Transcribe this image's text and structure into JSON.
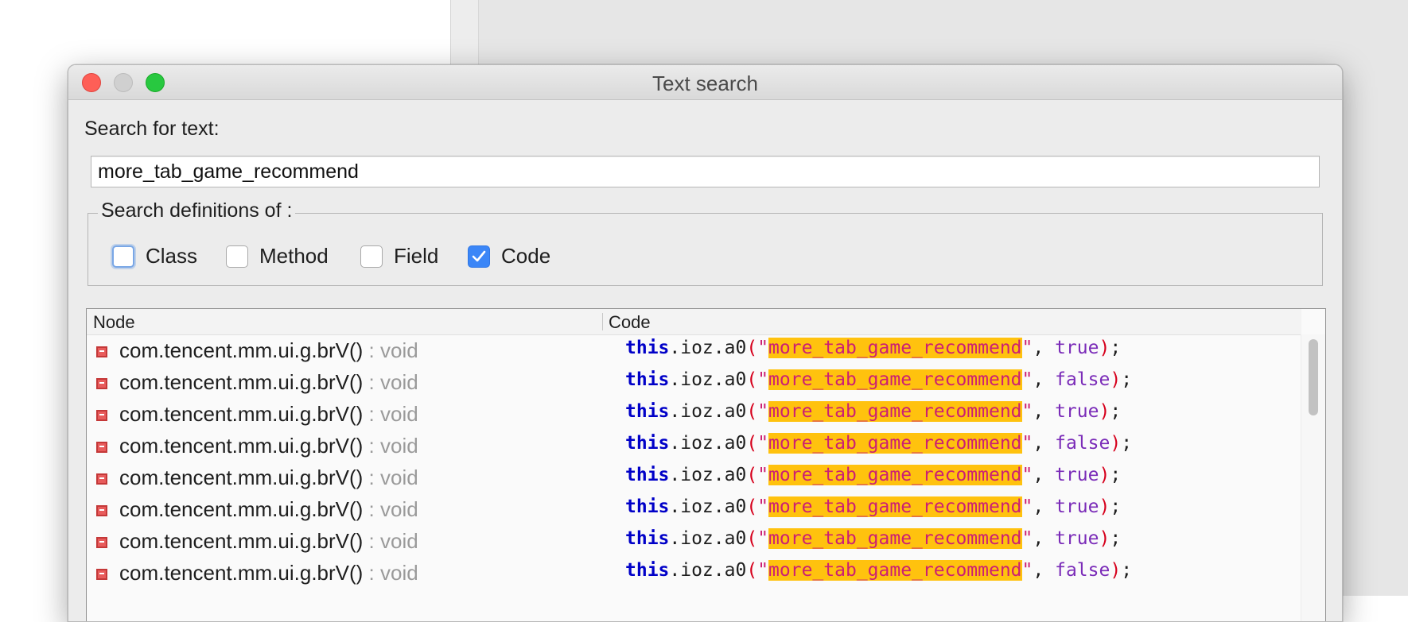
{
  "dialog": {
    "title": "Text search",
    "search_label": "Search for text:",
    "search_value": "more_tab_game_recommend",
    "definitions_legend": "Search definitions of :",
    "checkboxes": [
      {
        "label": "Class",
        "checked": false,
        "focused": true
      },
      {
        "label": "Method",
        "checked": false,
        "focused": false
      },
      {
        "label": "Field",
        "checked": false,
        "focused": false
      },
      {
        "label": "Code",
        "checked": true,
        "focused": false
      }
    ]
  },
  "results": {
    "columns": [
      "Node",
      "Code"
    ],
    "rows": [
      {
        "node": "com.tencent.mm.ui.g.brV()",
        "ret": " : void",
        "kw": "this",
        "pre": ".ioz.a0",
        "hl": "more_tab_game_recommend",
        "bool": "true"
      },
      {
        "node": "com.tencent.mm.ui.g.brV()",
        "ret": " : void",
        "kw": "this",
        "pre": ".ioz.a0",
        "hl": "more_tab_game_recommend",
        "bool": "false"
      },
      {
        "node": "com.tencent.mm.ui.g.brV()",
        "ret": " : void",
        "kw": "this",
        "pre": ".ioz.a0",
        "hl": "more_tab_game_recommend",
        "bool": "true"
      },
      {
        "node": "com.tencent.mm.ui.g.brV()",
        "ret": " : void",
        "kw": "this",
        "pre": ".ioz.a0",
        "hl": "more_tab_game_recommend",
        "bool": "false"
      },
      {
        "node": "com.tencent.mm.ui.g.brV()",
        "ret": " : void",
        "kw": "this",
        "pre": ".ioz.a0",
        "hl": "more_tab_game_recommend",
        "bool": "true"
      },
      {
        "node": "com.tencent.mm.ui.g.brV()",
        "ret": " : void",
        "kw": "this",
        "pre": ".ioz.a0",
        "hl": "more_tab_game_recommend",
        "bool": "true"
      },
      {
        "node": "com.tencent.mm.ui.g.brV()",
        "ret": " : void",
        "kw": "this",
        "pre": ".ioz.a0",
        "hl": "more_tab_game_recommend",
        "bool": "true"
      },
      {
        "node": "com.tencent.mm.ui.g.brV()",
        "ret": " : void",
        "kw": "this",
        "pre": ".ioz.a0",
        "hl": "more_tab_game_recommend",
        "bool": "false"
      }
    ]
  },
  "colors": {
    "keyword": "#0000c8",
    "highlight": "#ffc20e",
    "string": "#cc1f73",
    "boolean": "#7a2bb8",
    "checkbox_accent": "#3b86f7"
  }
}
